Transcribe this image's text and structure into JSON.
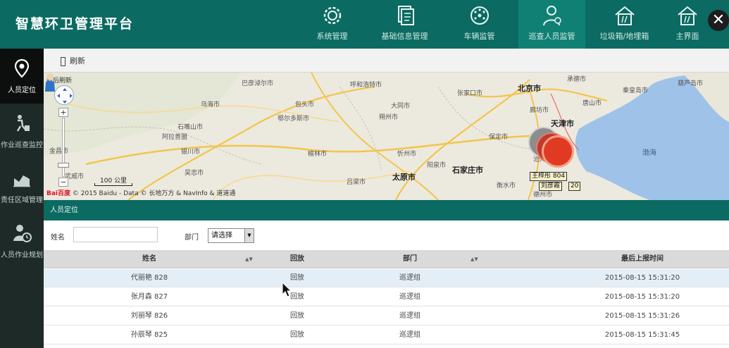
{
  "app": {
    "title": "智慧环卫管理平台"
  },
  "nav": [
    {
      "label": "系统管理",
      "icon": "gear-icon"
    },
    {
      "label": "基础信息管理",
      "icon": "documents-icon"
    },
    {
      "label": "车辆监管",
      "icon": "vehicle-dial-icon"
    },
    {
      "label": "巡查人员监管",
      "icon": "person-gear-icon",
      "active": true
    },
    {
      "label": "垃圾箱/地埋箱",
      "icon": "bin-house-icon"
    },
    {
      "label": "主界面",
      "icon": "home-icon"
    }
  ],
  "close": {
    "label": "✕"
  },
  "sidebar": [
    {
      "label": "人员定位",
      "icon": "location-pin-icon",
      "active": true
    },
    {
      "label": "作业巡查监控",
      "icon": "worker-icon"
    },
    {
      "label": "责任区域管理",
      "icon": "area-chart-icon"
    },
    {
      "label": "人员作业规划",
      "icon": "person-clock-icon"
    }
  ],
  "toolbar": {
    "refresh_label": "刷新"
  },
  "map": {
    "countdown": "秒后刷新",
    "scale": "100 公里",
    "copyright": "© 2015 Baidu - Data © 长地万方 & NavInfo & 道道通",
    "baidu_logo": "Bai百度",
    "sea": "渤海",
    "cities": [
      {
        "name": "北京市",
        "big": true
      },
      {
        "name": "天津市",
        "big": true
      },
      {
        "name": "石家庄市",
        "big": true
      },
      {
        "name": "太原市",
        "big": true
      },
      {
        "name": "秦皇岛市"
      },
      {
        "name": "唐山市"
      },
      {
        "name": "承德市"
      },
      {
        "name": "张家口市"
      },
      {
        "name": "大同市"
      },
      {
        "name": "保定市"
      },
      {
        "name": "沧州市"
      },
      {
        "name": "衡水市"
      },
      {
        "name": "阳泉市"
      },
      {
        "name": "忻州市"
      },
      {
        "name": "朔州市"
      },
      {
        "name": "吕梁市"
      },
      {
        "name": "榆林市"
      },
      {
        "name": "银川市"
      },
      {
        "name": "吴忠市"
      },
      {
        "name": "乌海市"
      },
      {
        "name": "鄂尔多斯市"
      },
      {
        "name": "呼和浩特市"
      },
      {
        "name": "巴彦淖尔市"
      },
      {
        "name": "包头市"
      },
      {
        "name": "阿拉善盟"
      },
      {
        "name": "石嘴山市"
      },
      {
        "name": "金昌市"
      },
      {
        "name": "武威市"
      },
      {
        "name": "德州市"
      },
      {
        "name": "廊坊市"
      },
      {
        "name": "葫芦岛市"
      }
    ],
    "tags": [
      "王梓彤 804",
      "刘彦霞",
      "20"
    ]
  },
  "panel": {
    "title": "人员定位"
  },
  "filters": {
    "name_label": "姓名",
    "name_placeholder": "",
    "dept_label": "部门",
    "dept_value": "请选择"
  },
  "table": {
    "columns": [
      "姓名",
      "回放",
      "部门",
      "最后上报时间"
    ],
    "rows": [
      {
        "name": "代丽艳 828",
        "replay": "回放",
        "dept": "巡逻组",
        "time": "2015-08-15 15:31:20"
      },
      {
        "name": "张月森 827",
        "replay": "回放",
        "dept": "巡逻组",
        "time": "2015-08-15 15:31:20"
      },
      {
        "name": "刘丽琴 826",
        "replay": "回放",
        "dept": "巡逻组",
        "time": "2015-08-15 15:31:26"
      },
      {
        "name": "孙辰琴 825",
        "replay": "回放",
        "dept": "巡逻组",
        "time": "2015-08-15 15:31:45"
      }
    ]
  }
}
